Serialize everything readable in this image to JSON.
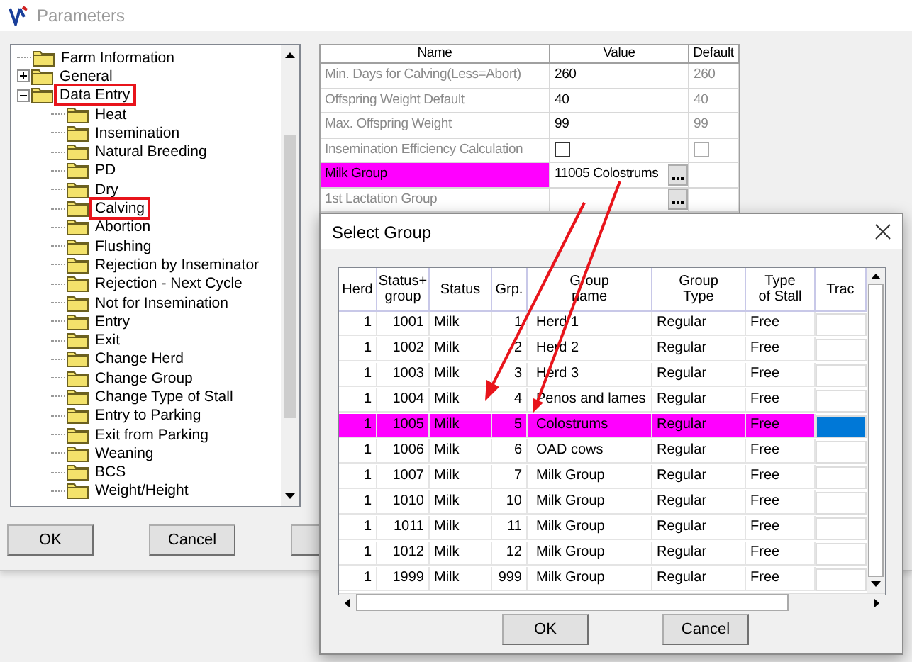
{
  "window": {
    "title": "Parameters"
  },
  "tree": [
    {
      "label": "Farm Information",
      "highlighted": false
    },
    {
      "label": "General",
      "expanded": false,
      "highlighted": false
    },
    {
      "label": "Data Entry",
      "expanded": true,
      "highlighted": true,
      "children": [
        {
          "label": "Heat",
          "highlighted": false
        },
        {
          "label": "Insemination",
          "highlighted": false
        },
        {
          "label": "Natural Breeding",
          "highlighted": false
        },
        {
          "label": "PD",
          "highlighted": false
        },
        {
          "label": "Dry",
          "highlighted": false
        },
        {
          "label": "Calving",
          "highlighted": true
        },
        {
          "label": "Abortion",
          "highlighted": false
        },
        {
          "label": "Flushing",
          "highlighted": false
        },
        {
          "label": "Rejection by Inseminator",
          "highlighted": false
        },
        {
          "label": "Rejection - Next Cycle",
          "highlighted": false
        },
        {
          "label": "Not for Insemination",
          "highlighted": false
        },
        {
          "label": "Entry",
          "highlighted": false
        },
        {
          "label": "Exit",
          "highlighted": false
        },
        {
          "label": "Change Herd",
          "highlighted": false
        },
        {
          "label": "Change Group",
          "highlighted": false
        },
        {
          "label": "Change Type of Stall",
          "highlighted": false
        },
        {
          "label": "Entry to Parking",
          "highlighted": false
        },
        {
          "label": "Exit from Parking",
          "highlighted": false
        },
        {
          "label": "Weaning",
          "highlighted": false
        },
        {
          "label": "BCS",
          "highlighted": false
        },
        {
          "label": "Weight/Height",
          "highlighted": false
        }
      ]
    }
  ],
  "properties": {
    "columns": [
      "Name",
      "Value",
      "Default"
    ],
    "rows": [
      {
        "kind": "text",
        "name": "Min. Days for Calving(Less=Abort)",
        "value": "260",
        "default": "260",
        "selected": false
      },
      {
        "kind": "text",
        "name": "Offspring Weight Default",
        "value": "40",
        "default": "40",
        "selected": false
      },
      {
        "kind": "text",
        "name": "Max. Offspring Weight",
        "value": "99",
        "default": "99",
        "selected": false
      },
      {
        "kind": "checkbox",
        "name": "Insemination Efficiency Calculation",
        "checked": false,
        "default_checked": false,
        "selected": false
      },
      {
        "kind": "picker",
        "name": "Milk Group",
        "value": "11005 Colostrums",
        "selected": true
      },
      {
        "kind": "picker",
        "name": "1st Lactation Group",
        "selected": false
      }
    ]
  },
  "buttons": [
    "OK",
    "Cancel"
  ],
  "dialog": {
    "title": "Select Group",
    "columns": [
      "Herd",
      "Status+\ngroup",
      "Status",
      "Grp.",
      "Group\nname",
      "Group\nType",
      "Type\nof Stall",
      "Trac"
    ],
    "rows": [
      {
        "cells": [
          "1",
          "1001",
          "Milk",
          "1",
          "Herd 1",
          "Regular",
          "Free"
        ],
        "selected": false
      },
      {
        "cells": [
          "1",
          "1002",
          "Milk",
          "2",
          "Herd 2",
          "Regular",
          "Free"
        ],
        "selected": false
      },
      {
        "cells": [
          "1",
          "1003",
          "Milk",
          "3",
          "Herd 3",
          "Regular",
          "Free"
        ],
        "selected": false
      },
      {
        "cells": [
          "1",
          "1004",
          "Milk",
          "4",
          "Penos and lames",
          "Regular",
          "Free"
        ],
        "selected": false
      },
      {
        "cells": [
          "1",
          "1005",
          "Milk",
          "5",
          "Colostrums",
          "Regular",
          "Free"
        ],
        "selected": true
      },
      {
        "cells": [
          "1",
          "1006",
          "Milk",
          "6",
          "OAD cows",
          "Regular",
          "Free"
        ],
        "selected": false
      },
      {
        "cells": [
          "1",
          "1007",
          "Milk",
          "7",
          "Milk Group",
          "Regular",
          "Free"
        ],
        "selected": false
      },
      {
        "cells": [
          "1",
          "1010",
          "Milk",
          "10",
          "Milk Group",
          "Regular",
          "Free"
        ],
        "selected": false
      },
      {
        "cells": [
          "1",
          "1011",
          "Milk",
          "11",
          "Milk Group",
          "Regular",
          "Free"
        ],
        "selected": false
      },
      {
        "cells": [
          "1",
          "1012",
          "Milk",
          "12",
          "Milk Group",
          "Regular",
          "Free"
        ],
        "selected": false
      },
      {
        "cells": [
          "1",
          "1999",
          "Milk",
          "999",
          "Milk Group",
          "Regular",
          "Free"
        ],
        "selected": false
      }
    ],
    "buttons": [
      "OK",
      "Cancel"
    ]
  }
}
